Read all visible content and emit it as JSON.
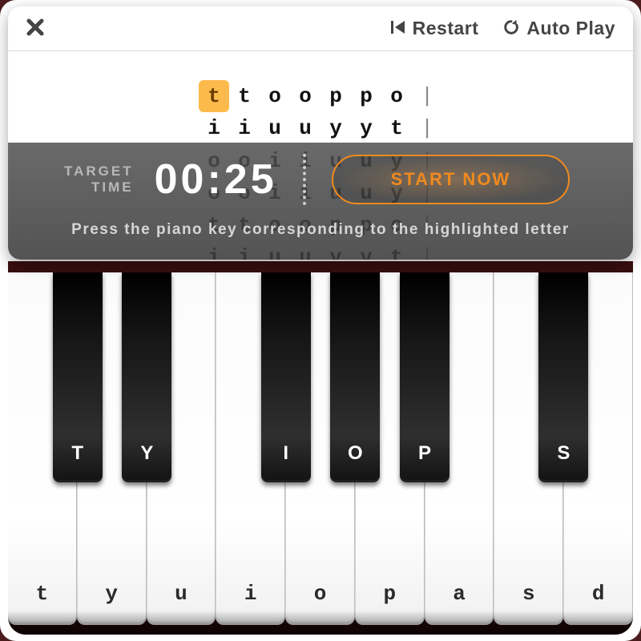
{
  "toolbar": {
    "restart_label": "Restart",
    "autoplay_label": "Auto Play"
  },
  "sheet": {
    "highlight_index": [
      0,
      0
    ],
    "rows": [
      [
        "t",
        "t",
        "o",
        "o",
        "p",
        "p",
        "o",
        "|"
      ],
      [
        "i",
        "i",
        "u",
        "u",
        "y",
        "y",
        "t",
        "|"
      ],
      [
        "o",
        "o",
        "i",
        "i",
        "u",
        "u",
        "y",
        "|"
      ],
      [
        "o",
        "o",
        "i",
        "i",
        "u",
        "u",
        "y",
        "|"
      ],
      [
        "t",
        "t",
        "o",
        "o",
        "p",
        "p",
        "o",
        "|"
      ],
      [
        "i",
        "i",
        "u",
        "u",
        "y",
        "y",
        "t",
        "|"
      ]
    ]
  },
  "overlay": {
    "target_label_line1": "TARGET",
    "target_label_line2": "TIME",
    "time": "00:25",
    "start_label": "START NOW",
    "hint": "Press the piano key corresponding to the highlighted letter"
  },
  "piano": {
    "white": [
      "t",
      "y",
      "u",
      "i",
      "o",
      "p",
      "a",
      "s",
      "d"
    ],
    "black": [
      {
        "label": "T",
        "after_white": 0
      },
      {
        "label": "Y",
        "after_white": 1
      },
      {
        "label": "I",
        "after_white": 3
      },
      {
        "label": "O",
        "after_white": 4
      },
      {
        "label": "P",
        "after_white": 5
      },
      {
        "label": "S",
        "after_white": 7
      }
    ]
  },
  "colors": {
    "accent": "#f08a1f"
  }
}
